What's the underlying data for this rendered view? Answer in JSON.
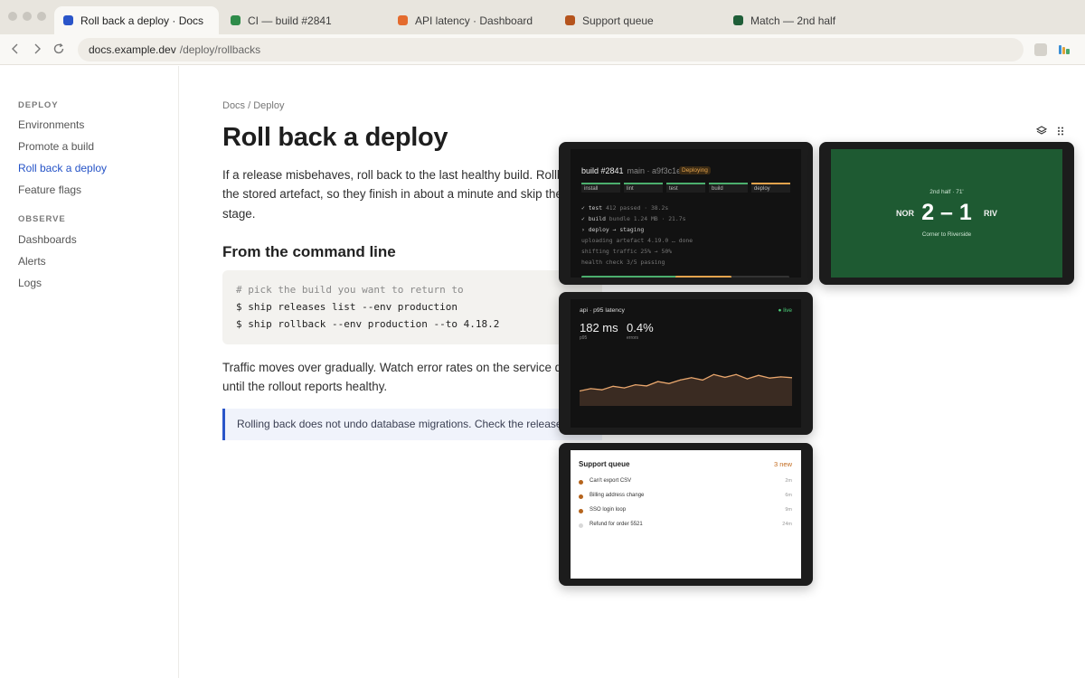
{
  "browser": {
    "tabs": [
      {
        "label": "Roll back a deploy · Docs",
        "color": "#2a55c9"
      },
      {
        "label": "CI — build #2841",
        "color": "#2e8b49"
      },
      {
        "label": "API latency · Dashboard",
        "color": "#e46b2e"
      },
      {
        "label": "Support queue",
        "color": "#b5541d"
      },
      {
        "label": "Match — 2nd half",
        "color": "#1f5e38"
      }
    ],
    "url_host": "docs.example.dev",
    "url_path": "/deploy/rollbacks",
    "icons": {
      "back": "chevron-left-icon",
      "forward": "chevron-right-icon",
      "reload": "reload-icon"
    }
  },
  "sidebar": {
    "sections": [
      {
        "heading": "DEPLOY",
        "items": [
          "Environments",
          "Promote a build",
          "Roll back a deploy",
          "Feature flags"
        ]
      },
      {
        "heading": "OBSERVE",
        "items": [
          "Dashboards",
          "Alerts",
          "Logs"
        ]
      }
    ],
    "active_item": "Roll back a deploy",
    "active_color": "#2553c7"
  },
  "doc": {
    "breadcrumb": "Docs / Deploy",
    "title": "Roll back a deploy",
    "intro_lines": [
      "If a release misbehaves, roll back to the last healthy build. Rollbac",
      "the stored artefact, so they finish in about a minute and skip the t",
      "stage."
    ],
    "section_heading": "From the command line",
    "code": [
      "# pick the build you want to return to",
      "$ ship releases list --env production",
      "$ ship rollback --env production --to 4.18.2"
    ],
    "after_lines": [
      "Traffic moves over gradually. Watch error rates on the service dasl",
      "until the rollout reports healthy."
    ],
    "callout": "Rolling back does not undo database migrations. Check the release no"
  },
  "toolbar": {
    "icons": [
      "layers-icon",
      "drag-handle-icon"
    ]
  },
  "ci": {
    "title": "build #2841",
    "branch": "main · a9f3c1e",
    "badge": "Deploying",
    "stages": [
      {
        "label": "install",
        "state": "done"
      },
      {
        "label": "lint",
        "state": "done"
      },
      {
        "label": "test",
        "state": "done"
      },
      {
        "label": "build",
        "state": "done"
      },
      {
        "label": "deploy",
        "state": "running"
      }
    ],
    "log": [
      {
        "main": "✓ test",
        "muted": " 412 passed · 38.2s"
      },
      {
        "main": "✓ build",
        "muted": " bundle 1.24 MB · 21.7s"
      },
      {
        "main": "› deploy → staging",
        "muted": ""
      },
      {
        "main": "",
        "muted": "uploading artefact 4.19.0 … done"
      },
      {
        "main": "",
        "muted": "shifting traffic 25% → 50%"
      },
      {
        "main": "",
        "muted": "health check 3/5 passing"
      }
    ],
    "progress": 0.72,
    "colors": {
      "done": "#4caf6e",
      "running": "#e3a34d"
    }
  },
  "match": {
    "period": "2nd half · 71'",
    "home": "NOR",
    "away": "RIV",
    "score": "2 – 1",
    "note": "Corner to Riverside"
  },
  "latency": {
    "title": "api · p95 latency",
    "live": "● live",
    "stats": [
      {
        "value": "182 ms",
        "label": "p95"
      },
      {
        "value": "0.4%",
        "label": "errors"
      }
    ],
    "chart_data": {
      "type": "area",
      "values": [
        118,
        124,
        121,
        130,
        126,
        134,
        131,
        142,
        137,
        146,
        152,
        146,
        160,
        153,
        160,
        149,
        158,
        151,
        154,
        152
      ],
      "ylim": [
        80,
        200
      ],
      "color": "#e8a66d"
    }
  },
  "support": {
    "title": "Support queue",
    "new_count": "3 new",
    "items": [
      {
        "text": "Can't export CSV",
        "time": "2m",
        "unread": true
      },
      {
        "text": "Billing address change",
        "time": "6m",
        "unread": true
      },
      {
        "text": "SSO login loop",
        "time": "9m",
        "unread": true
      },
      {
        "text": "Refund for order 5521",
        "time": "24m",
        "unread": false
      }
    ]
  }
}
